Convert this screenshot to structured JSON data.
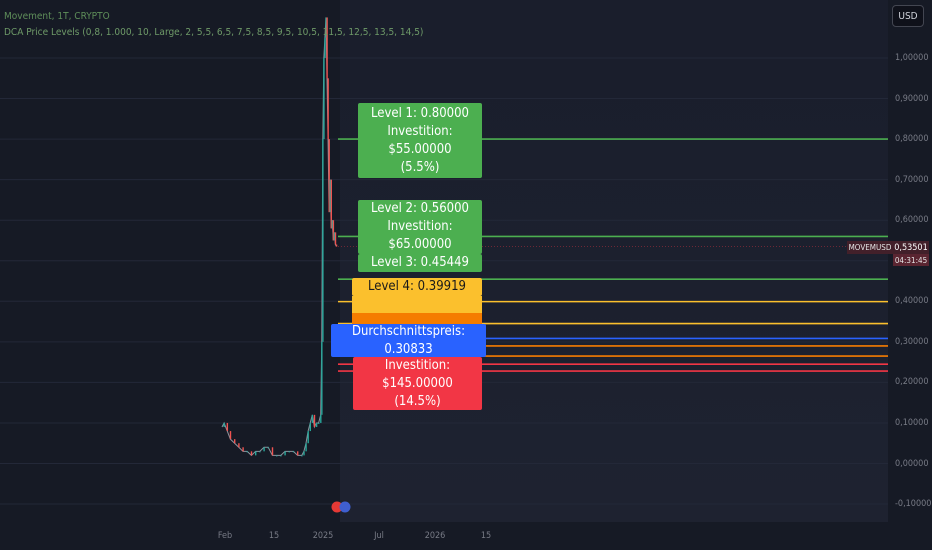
{
  "header": {
    "symbol_line": "Movement, 1T, CRYPTO",
    "indicator_line": "DCA Price Levels (0,8, 1.000, 10, Large, 2, 5,5, 6,5, 7,5, 8,5, 9,5, 10,5, 11,5, 12,5, 13,5, 14,5)"
  },
  "currency_button": "USD",
  "price_scale": {
    "symbol": "MOVEMUSD",
    "last_price": "0,53501",
    "countdown": "04:31:45"
  },
  "colors": {
    "background": "#161a25",
    "green": "#4caf50",
    "yellow": "#fbc02d",
    "orange": "#f57c00",
    "blue": "#2962ff",
    "red": "#f23645",
    "candle_up": "#26a69a",
    "candle_down": "#ef5350"
  },
  "labels": [
    {
      "lines": [
        "Level 1: 0.80000",
        "Investition: $55.00000",
        "(5.5%)"
      ],
      "color": "green"
    },
    {
      "lines": [
        "Level 2: 0.56000",
        "Investition: $65.00000"
      ],
      "color": "green"
    },
    {
      "lines": [
        "Level 3: 0.45449"
      ],
      "color": "green"
    },
    {
      "lines": [
        "Level 4: 0.39919"
      ],
      "color": "yellow"
    },
    {
      "lines": [
        "Durchschnittspreis: 0.30833"
      ],
      "color": "blue"
    },
    {
      "lines": [
        "Investition: $145.00000",
        "(14.5%)"
      ],
      "color": "red"
    }
  ],
  "chart_data": {
    "type": "line",
    "title": "Movement, 1T, CRYPTO",
    "y_ticks": [
      "1,00000",
      "0,90000",
      "0,80000",
      "0,70000",
      "0,60000",
      "0,50000",
      "0,40000",
      "0,30000",
      "0,20000",
      "0,10000",
      "0,00000",
      "-0,10000"
    ],
    "y_tick_values": [
      1.0,
      0.9,
      0.8,
      0.7,
      0.6,
      0.5,
      0.4,
      0.3,
      0.2,
      0.1,
      0.0,
      -0.1
    ],
    "ylim": [
      -0.12,
      1.13
    ],
    "x_ticks": [
      "Feb",
      "15",
      "2025",
      "Jul",
      "2026",
      "15"
    ],
    "levels": [
      {
        "name": "Level 1",
        "price": 0.8,
        "color": "green"
      },
      {
        "name": "Level 2",
        "price": 0.56,
        "color": "green"
      },
      {
        "name": "Level 3",
        "price": 0.45449,
        "color": "green"
      },
      {
        "name": "Level 4",
        "price": 0.39919,
        "color": "yellow"
      },
      {
        "price": 0.345,
        "color": "yellow"
      },
      {
        "name": "Durchschnittspreis",
        "price": 0.30833,
        "color": "blue"
      },
      {
        "price": 0.29,
        "color": "orange"
      },
      {
        "price": 0.265,
        "color": "orange"
      },
      {
        "price": 0.245,
        "color": "red"
      },
      {
        "price": 0.228,
        "color": "red"
      }
    ],
    "series": [
      {
        "values": [
          [
            0,
            0.09
          ],
          [
            2,
            0.1
          ],
          [
            5,
            0.08
          ],
          [
            8,
            0.06
          ],
          [
            12,
            0.05
          ],
          [
            16,
            0.04
          ],
          [
            20,
            0.03
          ],
          [
            24,
            0.03
          ],
          [
            28,
            0.02
          ],
          [
            32,
            0.03
          ],
          [
            36,
            0.03
          ],
          [
            40,
            0.04
          ],
          [
            44,
            0.04
          ],
          [
            48,
            0.02
          ],
          [
            52,
            0.02
          ],
          [
            56,
            0.02
          ],
          [
            60,
            0.03
          ],
          [
            64,
            0.03
          ],
          [
            68,
            0.03
          ],
          [
            72,
            0.02
          ],
          [
            76,
            0.02
          ],
          [
            78,
            0.03
          ],
          [
            80,
            0.05
          ],
          [
            82,
            0.08
          ],
          [
            84,
            0.1
          ],
          [
            86,
            0.12
          ],
          [
            88,
            0.09
          ],
          [
            90,
            0.1
          ],
          [
            92,
            0.1
          ],
          [
            94,
            0.12
          ],
          [
            95,
            0.3
          ],
          [
            96,
            0.8
          ],
          [
            97,
            1.0
          ],
          [
            98,
            1.05
          ],
          [
            99,
            1.1
          ],
          [
            100,
            0.95
          ],
          [
            101,
            0.8
          ],
          [
            102,
            0.62
          ],
          [
            103,
            0.7
          ],
          [
            104,
            0.58
          ],
          [
            105,
            0.6
          ],
          [
            106,
            0.55
          ],
          [
            107,
            0.57
          ],
          [
            108,
            0.54
          ],
          [
            109,
            0.535
          ]
        ]
      }
    ]
  }
}
